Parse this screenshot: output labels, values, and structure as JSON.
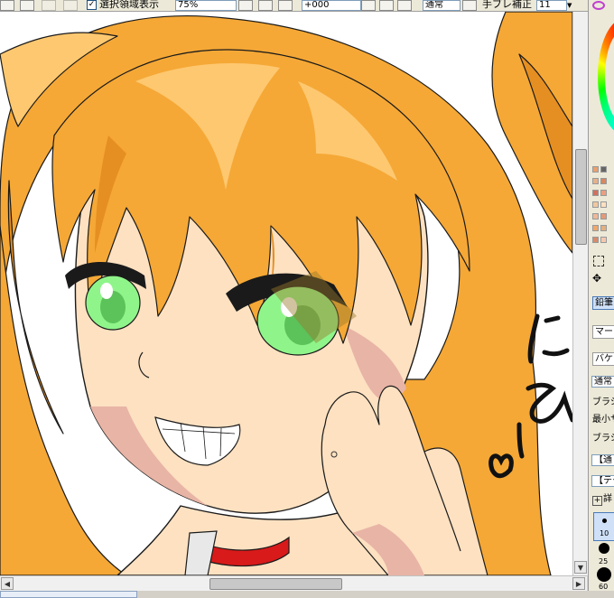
{
  "toolbar": {
    "show_selection_checked": true,
    "show_selection_label": "選択領域表示",
    "zoom_value": "75%",
    "rotation_value": "+000",
    "blend_mode": "通常",
    "stabilizer_label": "手ブレ補正",
    "stabilizer_value": "11"
  },
  "canvas": {
    "scribble_hiragana": [
      "に",
      "ひ",
      "ー"
    ],
    "colors": {
      "hair": "#f5a836",
      "hair_light": "#fec870",
      "hair_dark": "#e58f22",
      "skin": "#fde1c1",
      "skin_shadow": "#e8b4a6",
      "eye": "#8ff58a",
      "collar": "#d81a1a",
      "lineart": "#1a1a1a"
    }
  },
  "panel": {
    "tools": [
      "鉛筆",
      "マーカー",
      "バケツ"
    ],
    "blend_label": "通常",
    "brush_shape_label": "ブラシ",
    "min_size_label": "最小サ",
    "brush_texture_label": "ブラシ",
    "normal_option_label": "【通",
    "texture_option_label": "【テク",
    "detail_label": "詳",
    "brush_sizes": [
      "10",
      "25",
      "60"
    ]
  }
}
